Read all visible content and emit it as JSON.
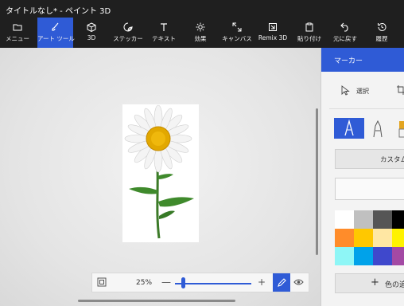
{
  "window": {
    "title": "タイトルなし* - ペイント 3D"
  },
  "toolbar": {
    "items": [
      {
        "label": "メニュー",
        "icon": "folder-icon"
      },
      {
        "label": "アート ツール",
        "icon": "brush-icon",
        "active": true
      },
      {
        "label": "3D",
        "icon": "cube-icon"
      },
      {
        "label": "ステッカー",
        "icon": "sticker-icon"
      },
      {
        "label": "テキスト",
        "icon": "text-icon"
      },
      {
        "label": "効果",
        "icon": "sun-icon"
      },
      {
        "label": "キャンバス",
        "icon": "canvas-icon"
      },
      {
        "label": "Remix 3D",
        "icon": "remix-icon"
      },
      {
        "label": "貼り付け",
        "icon": "paste-icon"
      },
      {
        "label": "元に戻す",
        "icon": "undo-icon"
      },
      {
        "label": "履歴",
        "icon": "history-icon"
      }
    ]
  },
  "zoom": {
    "percent": "25%",
    "level": 0.25
  },
  "panel": {
    "title": "マーカー",
    "select_label": "選択",
    "custom_label": "カスタム",
    "add_color_label": "色の追",
    "accent": "#2f5bd6",
    "swatches": [
      "#ffffff",
      "#c0c0c0",
      "#555555",
      "#000000",
      "#ff8c2a",
      "#ffc800",
      "#ffe7a3",
      "#fff200",
      "#8ef6f6",
      "#00a2ea",
      "#3f48cc",
      "#a349a4"
    ]
  }
}
